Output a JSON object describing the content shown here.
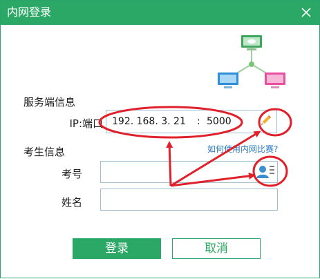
{
  "window": {
    "title": "内网登录"
  },
  "server": {
    "section_label": "服务端信息",
    "ip_label": "IP:端口",
    "ip": "192. 168. 3. 21",
    "colon": ":",
    "port": "5000"
  },
  "help_link": "如何使用内网比赛?",
  "examinee": {
    "section_label": "考生信息",
    "id_label": "考号",
    "id_value": "",
    "name_label": "姓名",
    "name_value": ""
  },
  "buttons": {
    "login": "登录",
    "cancel": "取消"
  },
  "colors": {
    "brand_green": "#2ba865",
    "annotation_red": "#e0202a",
    "link_blue": "#2a79c2"
  }
}
